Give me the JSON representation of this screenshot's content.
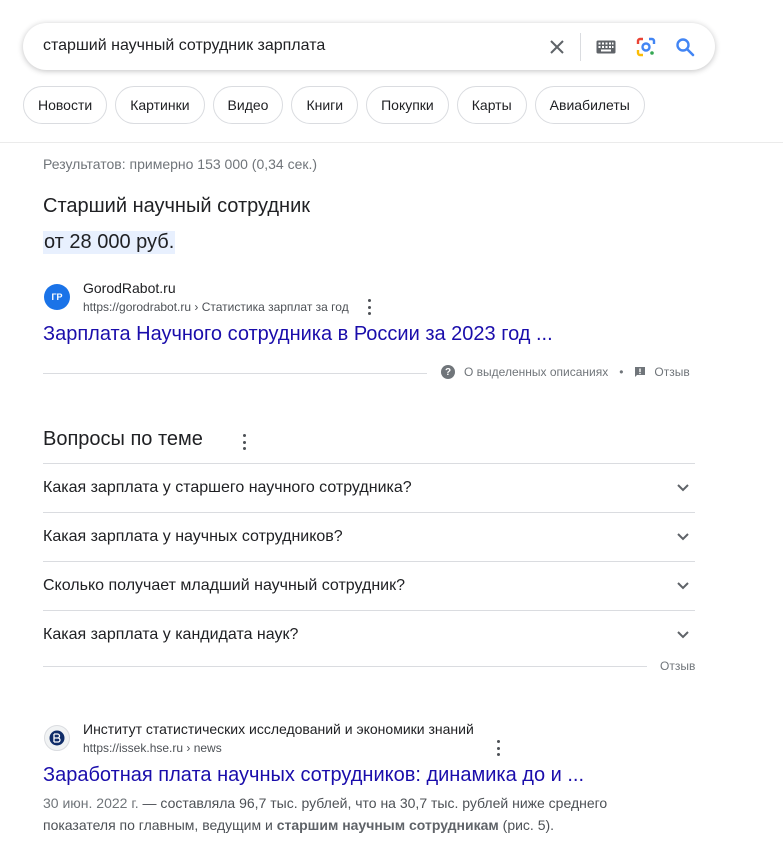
{
  "search": {
    "query": "старший научный сотрудник зарплата"
  },
  "icons": {
    "clear": "close-icon",
    "keyboard": "keyboard-icon",
    "lens": "camera-lens-icon",
    "search": "search-icon",
    "help": "help-circle-icon",
    "feedback": "feedback-icon",
    "more": "more-vert-icon",
    "expand": "chevron-down-icon"
  },
  "colors": {
    "link": "#1a0dab",
    "highlight": "#e8f0fe",
    "search_blue": "#4285f4"
  },
  "chips": [
    "Новости",
    "Картинки",
    "Видео",
    "Книги",
    "Покупки",
    "Карты",
    "Авиабилеты"
  ],
  "stats": "Результатов: примерно 153 000 (0,34 сек.)",
  "featured": {
    "title": "Старший научный сотрудник",
    "answer": "от 28 000 руб.",
    "source": {
      "favicon_text": "ГР",
      "name": "GorodRabot.ru",
      "url": "https://gorodrabot.ru › Статистика зарплат за год",
      "title": "Зарплата Научного сотрудника в России за 2023 год ..."
    },
    "about_label": "О выделенных описаниях",
    "separator": "•",
    "feedback_label": "Отзыв"
  },
  "paa": {
    "title": "Вопросы по теме",
    "questions": [
      "Какая зарплата у старшего научного сотрудника?",
      "Какая зарплата у научных сотрудников?",
      "Сколько получает младший научный сотрудник?",
      "Какая зарплата у кандидата наук?"
    ],
    "feedback_label": "Отзыв"
  },
  "result": {
    "favicon_text": "Вш",
    "site_name": "Институт статистических исследований и экономики знаний",
    "url": "https://issek.hse.ru › news",
    "title": "Заработная плата научных сотрудников: динамика до и ...",
    "snippet_date": "30 июн. 2022 г.",
    "snippet_dash": " — ",
    "snippet_text_1": "составляла 96,7 тыс. рублей, что на 30,7 тыс. рублей ниже среднего показателя по главным, ведущим и ",
    "snippet_bold": "старшим научным сотрудникам",
    "snippet_text_2": " (рис. 5)."
  }
}
